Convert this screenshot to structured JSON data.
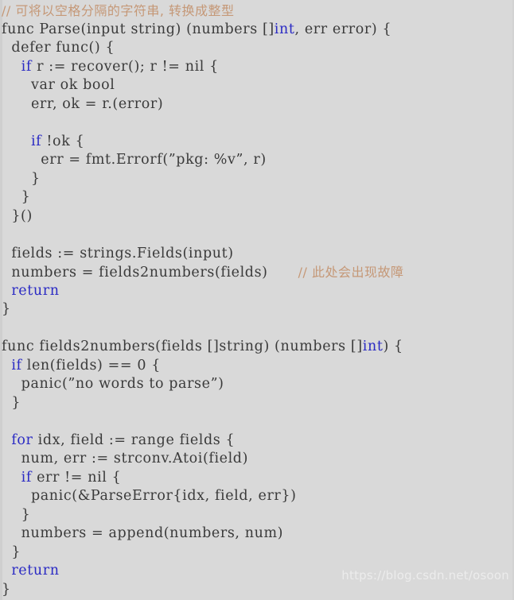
{
  "editor": {
    "background_color": "#d9d9d9",
    "default_text_color": "#3a3a3a",
    "keyword_color": "#2b2bc4",
    "comment_color": "#c59877",
    "language": "go"
  },
  "watermark": {
    "text": "https://blog.csdn.net/osoon",
    "color": "#ececec"
  },
  "code": {
    "lines": [
      {
        "n": 1,
        "indent": 0,
        "text": "// 可将以空格分隔的字符串, 转换成整型",
        "style": "comment-cn"
      },
      {
        "n": 2,
        "indent": 0,
        "text": "func Parse(input string) (numbers []int, err error) {",
        "keywords": [
          "int"
        ]
      },
      {
        "n": 3,
        "indent": 2,
        "text": "defer func() {"
      },
      {
        "n": 4,
        "indent": 4,
        "text": "if r := recover(); r != nil {",
        "keywords": [
          "if"
        ]
      },
      {
        "n": 5,
        "indent": 6,
        "text": "var ok bool"
      },
      {
        "n": 6,
        "indent": 6,
        "text": "err, ok = r.(error)"
      },
      {
        "n": 7,
        "indent": 0,
        "text": ""
      },
      {
        "n": 8,
        "indent": 6,
        "text": "if !ok {",
        "keywords": [
          "if"
        ]
      },
      {
        "n": 9,
        "indent": 8,
        "text": "err = fmt.Errorf(”pkg: %v”, r)"
      },
      {
        "n": 10,
        "indent": 6,
        "text": "}"
      },
      {
        "n": 11,
        "indent": 4,
        "text": "}"
      },
      {
        "n": 12,
        "indent": 2,
        "text": "}()"
      },
      {
        "n": 13,
        "indent": 0,
        "text": ""
      },
      {
        "n": 14,
        "indent": 2,
        "text": "fields := strings.Fields(input)"
      },
      {
        "n": 15,
        "indent": 2,
        "text": "numbers = fields2numbers(fields)",
        "inline_comment": "// 此处会出现故障"
      },
      {
        "n": 16,
        "indent": 2,
        "text": "return",
        "keywords": [
          "return"
        ]
      },
      {
        "n": 17,
        "indent": 0,
        "text": "}"
      },
      {
        "n": 18,
        "indent": 0,
        "text": ""
      },
      {
        "n": 19,
        "indent": 0,
        "text": "func fields2numbers(fields []string) (numbers []int) {",
        "keywords": [
          "int"
        ]
      },
      {
        "n": 20,
        "indent": 2,
        "text": "if len(fields) == 0 {",
        "keywords": [
          "if"
        ]
      },
      {
        "n": 21,
        "indent": 4,
        "text": "panic(”no words to parse”)"
      },
      {
        "n": 22,
        "indent": 2,
        "text": "}"
      },
      {
        "n": 23,
        "indent": 0,
        "text": ""
      },
      {
        "n": 24,
        "indent": 2,
        "text": "for idx, field := range fields {",
        "keywords": [
          "for"
        ]
      },
      {
        "n": 25,
        "indent": 4,
        "text": "num, err := strconv.Atoi(field)"
      },
      {
        "n": 26,
        "indent": 4,
        "text": "if err != nil {",
        "keywords": [
          "if"
        ]
      },
      {
        "n": 27,
        "indent": 6,
        "text": "panic(&ParseError{idx, field, err})"
      },
      {
        "n": 28,
        "indent": 4,
        "text": "}"
      },
      {
        "n": 29,
        "indent": 4,
        "text": "numbers = append(numbers, num)"
      },
      {
        "n": 30,
        "indent": 2,
        "text": "}"
      },
      {
        "n": 31,
        "indent": 2,
        "text": "return",
        "keywords": [
          "return"
        ]
      },
      {
        "n": 32,
        "indent": 0,
        "text": "}"
      }
    ]
  }
}
